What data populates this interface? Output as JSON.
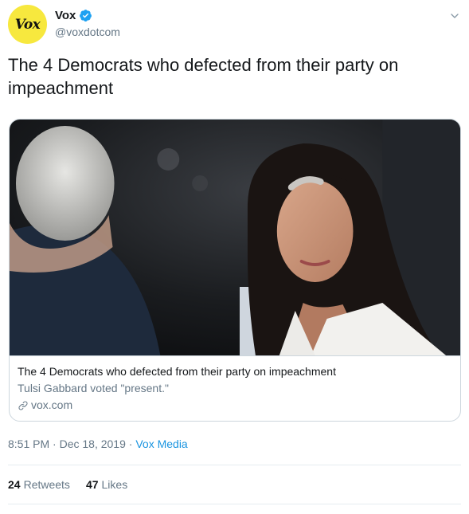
{
  "account": {
    "avatar_text": "Vox",
    "display_name": "Vox",
    "handle": "@voxdotcom",
    "verified": true
  },
  "tweet": {
    "text": "The 4 Democrats who defected from their party on impeachment"
  },
  "card": {
    "title": "The 4 Democrats who defected from their party on impeachment",
    "description": "Tulsi Gabbard voted \"present.\"",
    "domain": "vox.com"
  },
  "meta": {
    "time": "8:51 PM",
    "separator": "·",
    "date": "Dec 18, 2019",
    "source": "Vox Media"
  },
  "stats": {
    "retweets_count": "24",
    "retweets_label": "Retweets",
    "likes_count": "47",
    "likes_label": "Likes"
  },
  "colors": {
    "accent": "#1b95e0",
    "avatar_bg": "#f7e83e",
    "secondary_text": "#657786",
    "border": "#ccd6dd"
  },
  "icons": {
    "verified": "verified-badge-icon",
    "caret": "chevron-down-icon",
    "link": "link-icon"
  }
}
